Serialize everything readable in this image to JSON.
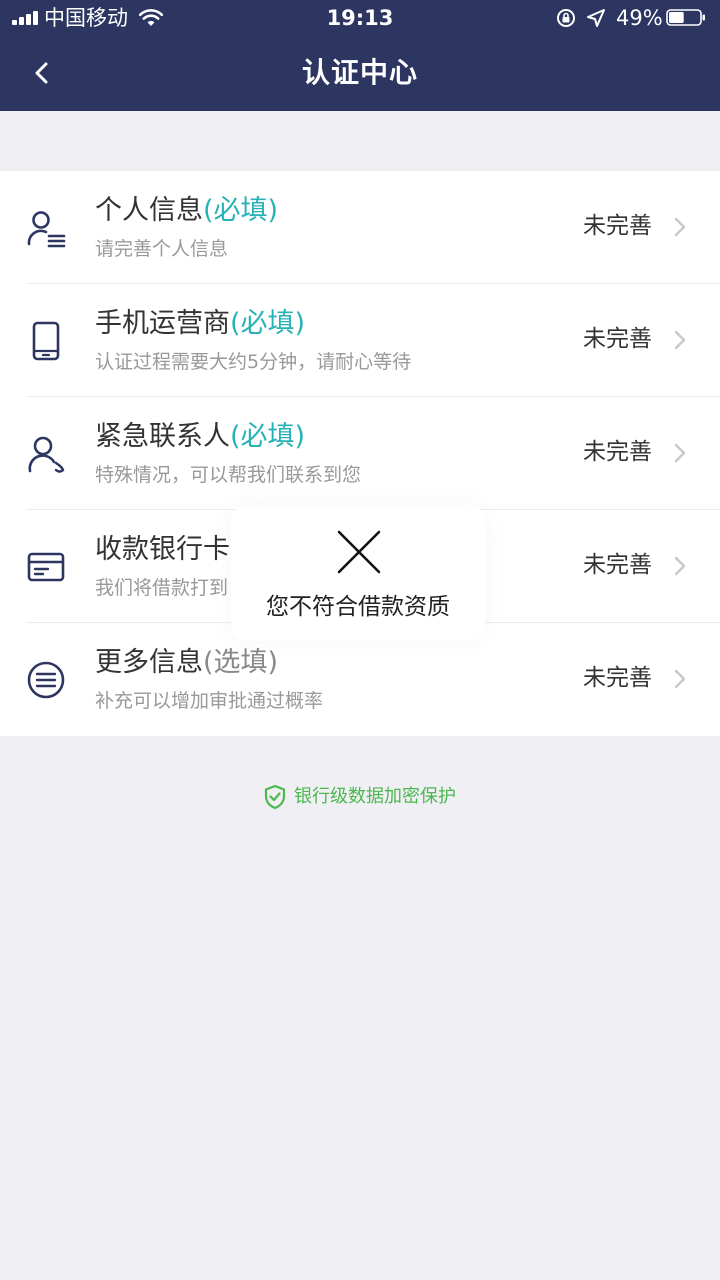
{
  "status_bar": {
    "carrier": "中国移动",
    "time": "19:13",
    "battery_percent": "49%",
    "battery_level": 0.49
  },
  "nav": {
    "title": "认证中心",
    "back_icon": "chevron-left-icon"
  },
  "items": [
    {
      "title": "个人信息",
      "tag": "(必填)",
      "subtitle": "请完善个人信息",
      "status": "未完善",
      "icon": "person-list-icon"
    },
    {
      "title": "手机运营商",
      "tag": "(必填)",
      "subtitle": "认证过程需要大约5分钟，请耐心等待",
      "status": "未完善",
      "icon": "phone-icon"
    },
    {
      "title": "紧急联系人",
      "tag": "(必填)",
      "subtitle": "特殊情况，可以帮我们联系到您",
      "status": "未完善",
      "icon": "person-call-icon"
    },
    {
      "title": "收款银行卡",
      "tag": "",
      "subtitle": "我们将借款打到",
      "status": "未完善",
      "icon": "bank-card-icon"
    },
    {
      "title": "更多信息",
      "tag": "(选填)",
      "subtitle": "补充可以增加审批通过概率",
      "status": "未完善",
      "icon": "list-circle-icon"
    }
  ],
  "security": {
    "label": "银行级数据加密保护",
    "icon": "shield-check-icon"
  },
  "toast": {
    "message": "您不符合借款资质",
    "icon": "close-icon"
  },
  "colors": {
    "header_bg": "#2d3561",
    "accent_teal": "#27b2b5",
    "security_green": "#4cb84f",
    "page_bg": "#efeff4"
  }
}
